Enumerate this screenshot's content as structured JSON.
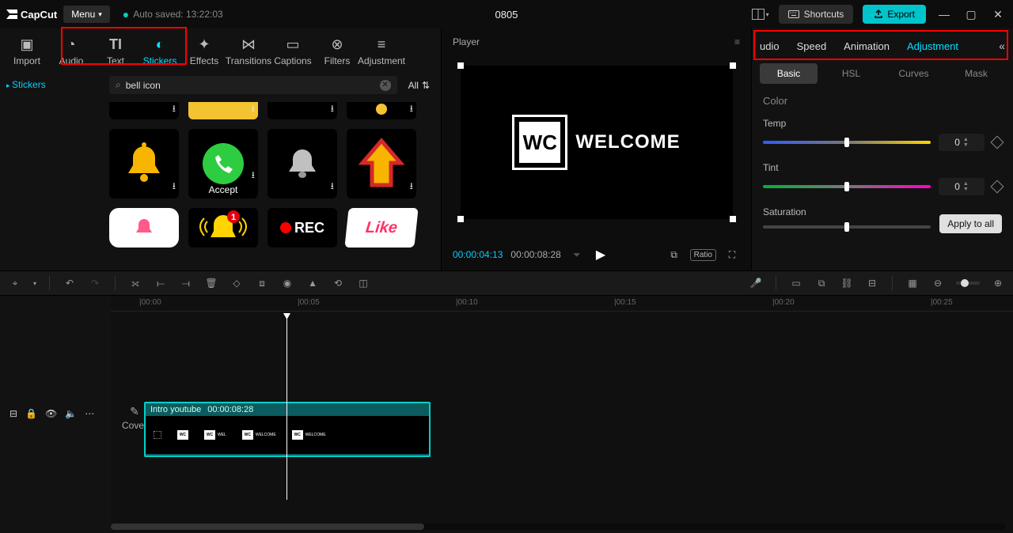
{
  "app": {
    "name": "CapCut",
    "menu": "Menu",
    "autosave": "Auto saved: 13:22:03",
    "title": "0805"
  },
  "topbuttons": {
    "shortcuts": "Shortcuts",
    "export": "Export"
  },
  "media_tabs": [
    "Import",
    "Audio",
    "Text",
    "Stickers",
    "Effects",
    "Transitions",
    "Captions",
    "Filters",
    "Adjustment"
  ],
  "media_tabs_active": 3,
  "sidebar_tag": "Stickers",
  "search": {
    "value": "bell icon",
    "all": "All"
  },
  "stickers": {
    "row0": [
      {
        "id": "p1"
      },
      {
        "id": "p2"
      },
      {
        "id": "p3"
      },
      {
        "id": "p4"
      }
    ],
    "row1": [
      {
        "id": "bell-yellow"
      },
      {
        "id": "accept",
        "caption": "Accept"
      },
      {
        "id": "silver-bell"
      },
      {
        "id": "arrow-up"
      }
    ],
    "row2": [
      {
        "id": "bell-pink"
      },
      {
        "id": "bell-notif"
      },
      {
        "id": "rec",
        "caption": "REC"
      },
      {
        "id": "like",
        "caption": "Like"
      }
    ]
  },
  "player": {
    "label": "Player",
    "wc": "WC",
    "welcome": "WELCOME",
    "tc1": "00:00:04:13",
    "tc2": "00:00:08:28",
    "ratio": "Ratio"
  },
  "inspector": {
    "tabs": [
      "udio",
      "Speed",
      "Animation",
      "Adjustment"
    ],
    "active": 3,
    "subtabs": [
      "Basic",
      "HSL",
      "Curves",
      "Mask"
    ],
    "sub_active": 0,
    "section": "Color",
    "temp": {
      "label": "Temp",
      "value": "0"
    },
    "tint": {
      "label": "Tint",
      "value": "0"
    },
    "sat": {
      "label": "Saturation"
    },
    "apply": "Apply to all"
  },
  "timeline": {
    "ticks": [
      "00:00",
      "00:05",
      "00:10",
      "00:15",
      "00:20",
      "00:25"
    ],
    "clip": {
      "name": "Intro youtube",
      "dur": "00:00:08:28"
    },
    "cover": "Cover"
  }
}
